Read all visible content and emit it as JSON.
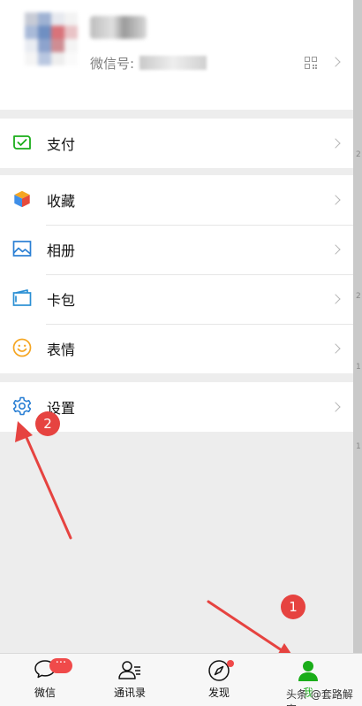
{
  "profile": {
    "wechat_id_label": "微信号:"
  },
  "menu": {
    "pay": "支付",
    "favorites": "收藏",
    "album": "相册",
    "cards": "卡包",
    "stickers": "表情",
    "settings": "设置"
  },
  "tabbar": {
    "chats": "微信",
    "chats_badge": "···",
    "contacts": "通讯录",
    "discover": "发现",
    "me": "我"
  },
  "annotations": {
    "step1": "1",
    "step2": "2"
  },
  "watermark": "头条 @套路解密",
  "colors": {
    "wechat_green": "#1aad19",
    "badge_red": "#f04a4a",
    "annotation_red": "#e64340"
  },
  "icons": {
    "pay": "wallet-check-icon",
    "favorites": "cube-icon",
    "album": "image-icon",
    "cards": "card-wallet-icon",
    "stickers": "smiley-icon",
    "settings": "gear-icon"
  }
}
